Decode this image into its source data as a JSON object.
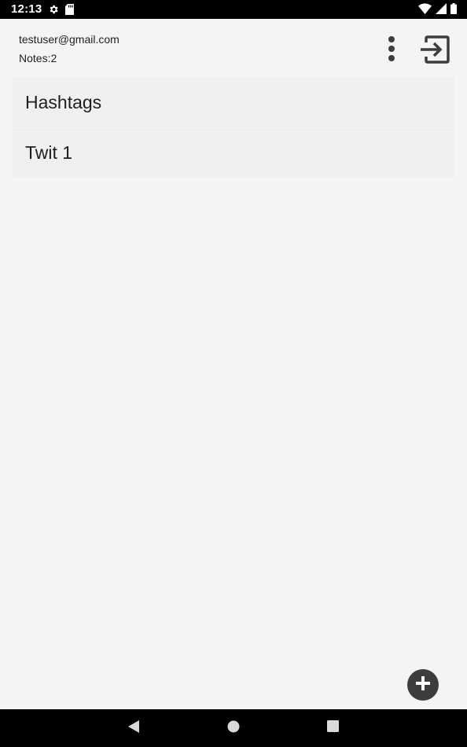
{
  "status_bar": {
    "time": "12:13",
    "icons": [
      "settings-icon",
      "sd-card-icon",
      "wifi-icon",
      "signal-icon",
      "battery-icon"
    ]
  },
  "header": {
    "email": "testuser@gmail.com",
    "notes_count": "Notes:2",
    "overflow_icon": "more-vert-icon",
    "logout_icon": "exit-icon"
  },
  "notes": [
    {
      "title": "Hashtags"
    },
    {
      "title": "Twit 1"
    }
  ],
  "fab": {
    "icon": "plus-icon"
  },
  "nav_bar": {
    "icons": [
      "back-icon",
      "home-icon",
      "recents-icon"
    ]
  },
  "colors": {
    "background": "#f4f4f4",
    "list_item": "#f0f0f0",
    "icon_dark": "#3d3d3d",
    "bars": "#000000"
  }
}
